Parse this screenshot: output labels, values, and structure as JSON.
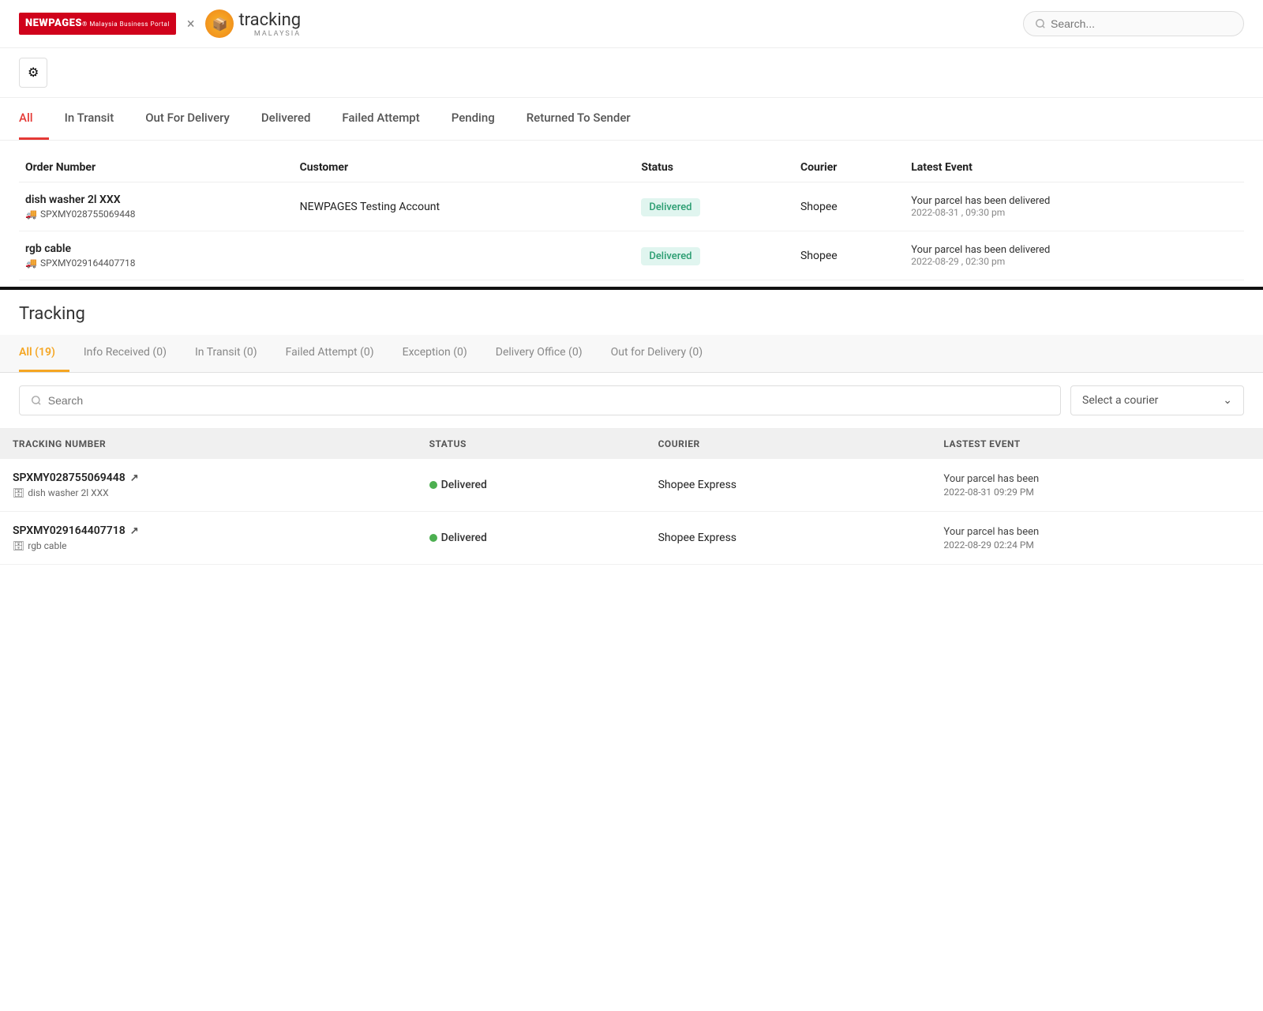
{
  "header": {
    "search_placeholder": "Search..."
  },
  "top_tabs": [
    {
      "label": "All",
      "active": true
    },
    {
      "label": "In Transit",
      "active": false
    },
    {
      "label": "Out For Delivery",
      "active": false
    },
    {
      "label": "Delivered",
      "active": false
    },
    {
      "label": "Failed Attempt",
      "active": false
    },
    {
      "label": "Pending",
      "active": false
    },
    {
      "label": "Returned To Sender",
      "active": false
    }
  ],
  "orders_table": {
    "columns": [
      "Order Number",
      "Customer",
      "Status",
      "Courier",
      "Latest Event"
    ],
    "rows": [
      {
        "order_name": "dish washer 2l XXX",
        "tracking_num": "SPXMY028755069448",
        "customer": "NEWPAGES Testing Account",
        "status": "Delivered",
        "courier": "Shopee",
        "event_text": "Your parcel has been delivered",
        "event_date": "2022-08-31 , 09:30 pm"
      },
      {
        "order_name": "rgb cable",
        "tracking_num": "SPXMY029164407718",
        "customer": "",
        "status": "Delivered",
        "courier": "Shopee",
        "event_text": "Your parcel has been delivered",
        "event_date": "2022-08-29 , 02:30 pm"
      }
    ]
  },
  "tracking_section": {
    "title": "Tracking",
    "tabs": [
      {
        "label": "All (19)",
        "active": true
      },
      {
        "label": "Info Received (0)",
        "active": false
      },
      {
        "label": "In Transit (0)",
        "active": false
      },
      {
        "label": "Failed Attempt (0)",
        "active": false
      },
      {
        "label": "Exception (0)",
        "active": false
      },
      {
        "label": "Delivery Office (0)",
        "active": false
      },
      {
        "label": "Out for Delivery (0)",
        "active": false
      }
    ],
    "search_placeholder": "Search",
    "courier_placeholder": "Select a courier",
    "table": {
      "columns": [
        "TRACKING NUMBER",
        "STATUS",
        "COURIER",
        "LASTEST EVENT"
      ],
      "rows": [
        {
          "tracking_num": "SPXMY028755069448",
          "order_name": "dish washer 2l XXX",
          "status": "Delivered",
          "courier": "Shopee Express",
          "event_text": "Your parcel has been",
          "event_date": "2022-08-31 09:29 PM"
        },
        {
          "tracking_num": "SPXMY029164407718",
          "order_name": "rgb cable",
          "status": "Delivered",
          "courier": "Shopee Express",
          "event_text": "Your parcel has been",
          "event_date": "2022-08-29 02:24 PM"
        }
      ]
    }
  },
  "icons": {
    "search": "🔍",
    "gear": "⚙",
    "truck": "🚚",
    "archive": "🗄",
    "share": "↗",
    "chevron_down": "⌄"
  }
}
